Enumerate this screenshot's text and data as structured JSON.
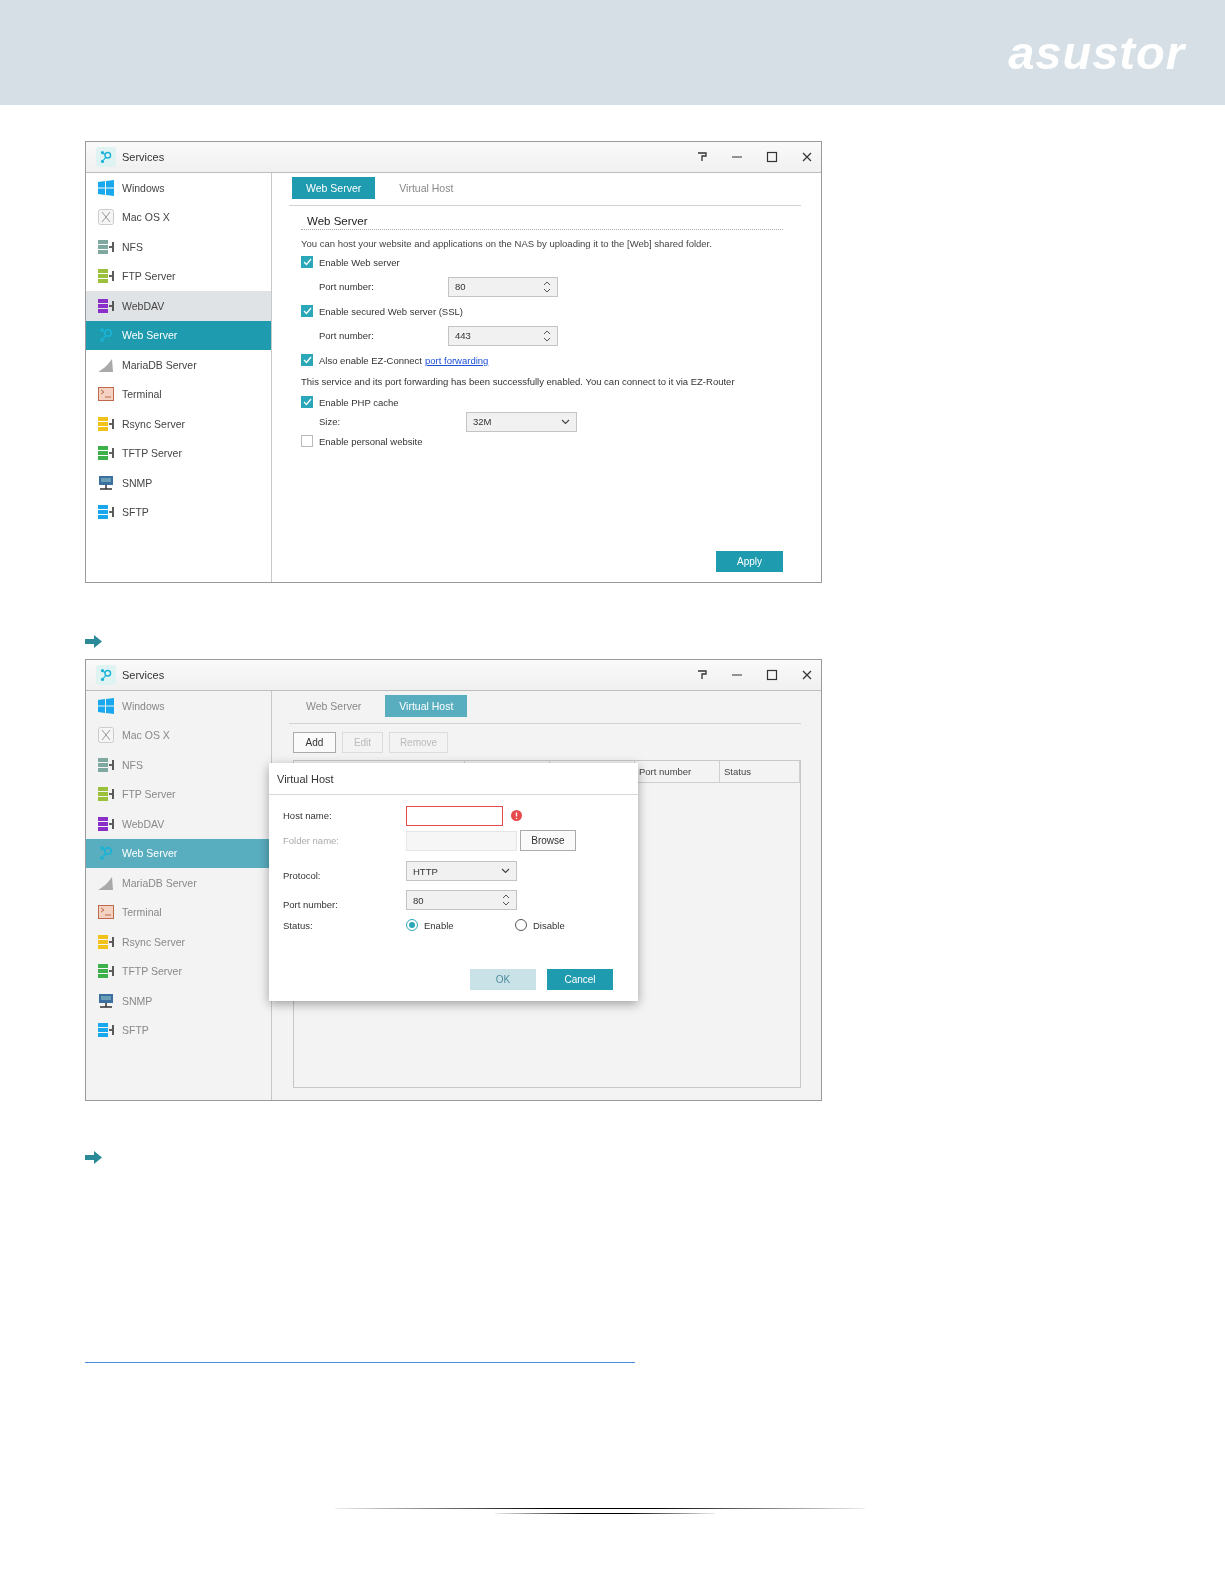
{
  "header": {
    "logo": "asustor"
  },
  "windows": [
    {
      "title": "Services",
      "dimmed": false,
      "sidebar": {
        "items": [
          {
            "label": "Windows",
            "selected": false,
            "hovered": false
          },
          {
            "label": "Mac OS X",
            "selected": false,
            "hovered": false
          },
          {
            "label": "NFS",
            "selected": false,
            "hovered": false
          },
          {
            "label": "FTP Server",
            "selected": false,
            "hovered": false
          },
          {
            "label": "WebDAV",
            "selected": false,
            "hovered": true
          },
          {
            "label": "Web Server",
            "selected": true,
            "hovered": false
          },
          {
            "label": "MariaDB Server",
            "selected": false,
            "hovered": false
          },
          {
            "label": "Terminal",
            "selected": false,
            "hovered": false
          },
          {
            "label": "Rsync Server",
            "selected": false,
            "hovered": false
          },
          {
            "label": "TFTP Server",
            "selected": false,
            "hovered": false
          },
          {
            "label": "SNMP",
            "selected": false,
            "hovered": false
          },
          {
            "label": "SFTP",
            "selected": false,
            "hovered": false
          }
        ]
      },
      "tabs": [
        {
          "label": "Web Server",
          "selected": true
        },
        {
          "label": "Virtual Host",
          "selected": false
        }
      ],
      "form": {
        "section_title": "Web Server",
        "description": "You can host your website and applications on the NAS by uploading it to the [Web] shared folder.",
        "rows": [
          {
            "kind": "checkbox",
            "label": "Enable Web server",
            "checked": true
          },
          {
            "kind": "spinner",
            "label": "Port number:",
            "value": "80"
          },
          {
            "kind": "checkbox",
            "label": "Enable secured Web server (SSL)",
            "checked": true
          },
          {
            "kind": "spinner",
            "label": "Port number:",
            "value": "443"
          },
          {
            "kind": "checkbox",
            "label": "Also enable EZ-Connect",
            "link": "port forwarding",
            "checked": true
          },
          {
            "kind": "note",
            "text": "This service and its port forwarding has been successfully enabled. You can connect to it via EZ-Router"
          },
          {
            "kind": "checkbox",
            "label": "Enable PHP cache",
            "checked": true
          },
          {
            "kind": "select",
            "label": "Size:",
            "value": "32M"
          },
          {
            "kind": "checkbox",
            "label": "Enable personal website",
            "checked": false
          }
        ],
        "apply_button": "Apply"
      }
    },
    {
      "title": "Services",
      "dimmed": true,
      "sidebar": {
        "items": [
          {
            "label": "Windows",
            "selected": false,
            "hovered": false
          },
          {
            "label": "Mac OS X",
            "selected": false,
            "hovered": false
          },
          {
            "label": "NFS",
            "selected": false,
            "hovered": false
          },
          {
            "label": "FTP Server",
            "selected": false,
            "hovered": false
          },
          {
            "label": "WebDAV",
            "selected": false,
            "hovered": false
          },
          {
            "label": "Web Server",
            "selected": true,
            "hovered": false
          },
          {
            "label": "MariaDB Server",
            "selected": false,
            "hovered": false
          },
          {
            "label": "Terminal",
            "selected": false,
            "hovered": false
          },
          {
            "label": "Rsync Server",
            "selected": false,
            "hovered": false
          },
          {
            "label": "TFTP Server",
            "selected": false,
            "hovered": false
          },
          {
            "label": "SNMP",
            "selected": false,
            "hovered": false
          },
          {
            "label": "SFTP",
            "selected": false,
            "hovered": false
          }
        ]
      },
      "tabs": [
        {
          "label": "Web Server",
          "selected": false
        },
        {
          "label": "Virtual Host",
          "selected": true
        }
      ],
      "toolbar": [
        {
          "label": "Add",
          "disabled": false
        },
        {
          "label": "Edit",
          "disabled": true
        },
        {
          "label": "Remove",
          "disabled": true
        }
      ],
      "table": {
        "columns": [
          {
            "label": "Port number"
          },
          {
            "label": "Status"
          }
        ]
      },
      "dialog": {
        "title": "Virtual Host",
        "rows": [
          {
            "kind": "text",
            "label": "Host name:",
            "error": true,
            "disabled": false
          },
          {
            "kind": "browse",
            "label": "Folder name:",
            "disabled": true,
            "button": "Browse"
          },
          {
            "kind": "select",
            "label": "Protocol:",
            "value": "HTTP",
            "disabled": false
          },
          {
            "kind": "spinner",
            "label": "Port number:",
            "value": "80",
            "disabled": false
          },
          {
            "kind": "radio",
            "label": "Status:",
            "disabled": false,
            "options": [
              {
                "label": "Enable",
                "selected": true
              },
              {
                "label": "Disable",
                "selected": false
              }
            ]
          }
        ],
        "buttons": [
          {
            "label": "OK",
            "disabled": true
          },
          {
            "label": "Cancel",
            "disabled": false
          }
        ]
      }
    }
  ]
}
